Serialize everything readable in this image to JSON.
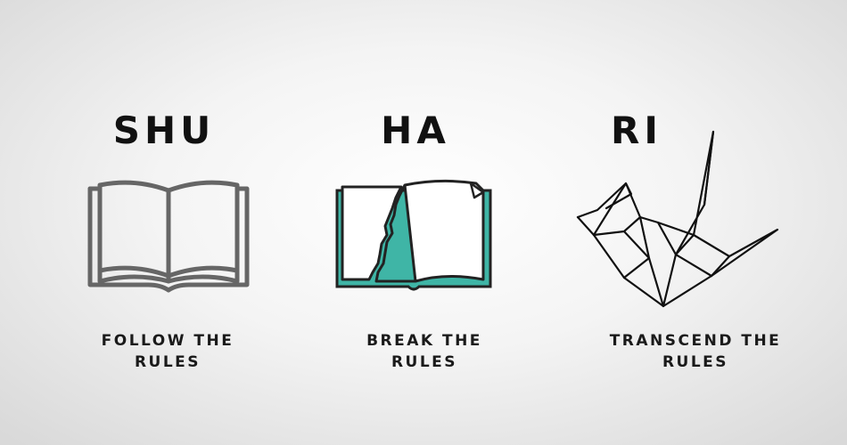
{
  "columns": [
    {
      "heading": "SHU",
      "caption_line1": "FOLLOW THE",
      "caption_line2": "RULES",
      "icon": "open-book-icon",
      "icon_color": "#666666"
    },
    {
      "heading": "HA",
      "caption_line1": "BREAK THE",
      "caption_line2": "RULES",
      "icon": "torn-book-icon",
      "icon_color": "#3fb5a6"
    },
    {
      "heading": "RI",
      "caption_line1": "TRANSCEND THE",
      "caption_line2": "RULES",
      "icon": "origami-crane-icon",
      "icon_color": "#111111"
    }
  ]
}
